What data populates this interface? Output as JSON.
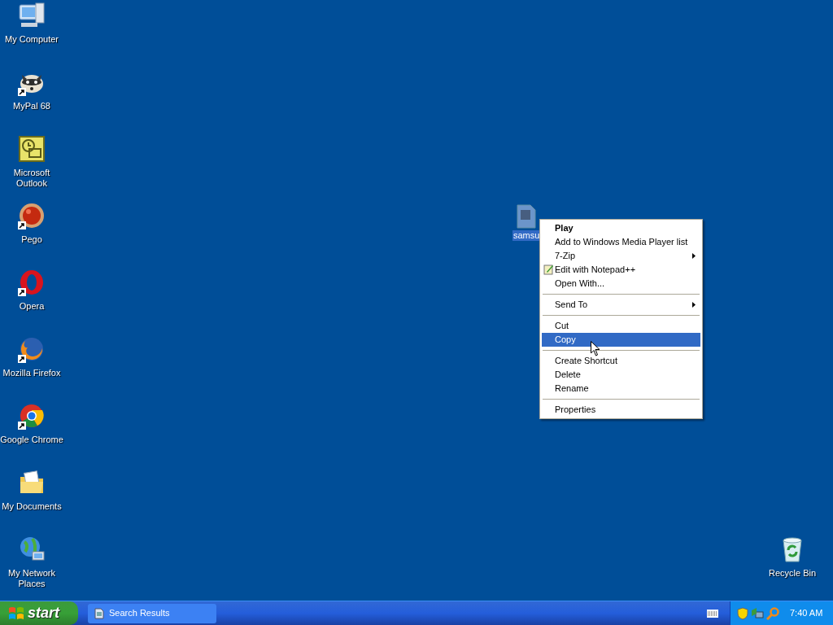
{
  "desktop_icons": [
    {
      "label": "My Computer",
      "kind": "computer",
      "shortcut": false
    },
    {
      "label": "MyPal 68",
      "kind": "raccoon",
      "shortcut": true
    },
    {
      "label": "Microsoft Outlook",
      "kind": "outlook",
      "shortcut": false
    },
    {
      "label": "Pego",
      "kind": "pego",
      "shortcut": true
    },
    {
      "label": "Opera",
      "kind": "opera",
      "shortcut": true
    },
    {
      "label": "Mozilla Firefox",
      "kind": "firefox",
      "shortcut": true
    },
    {
      "label": "Google Chrome",
      "kind": "chrome",
      "shortcut": true
    },
    {
      "label": "My Documents",
      "kind": "documents",
      "shortcut": false
    },
    {
      "label": "My Network Places",
      "kind": "network",
      "shortcut": false
    }
  ],
  "recycle_bin": {
    "label": "Recycle Bin"
  },
  "file_icon": {
    "label": "samsu",
    "selected": true
  },
  "context_menu": {
    "items": [
      {
        "kind": "item",
        "label": "Play",
        "default": true,
        "submenu": false,
        "has_icon": false,
        "selected": false
      },
      {
        "kind": "item",
        "label": "Add to Windows Media Player list",
        "default": false,
        "submenu": false,
        "has_icon": false,
        "selected": false
      },
      {
        "kind": "item",
        "label": "7-Zip",
        "default": false,
        "submenu": true,
        "has_icon": false,
        "selected": false
      },
      {
        "kind": "item",
        "label": "Edit with Notepad++",
        "default": false,
        "submenu": false,
        "has_icon": true,
        "selected": false
      },
      {
        "kind": "item",
        "label": "Open With...",
        "default": false,
        "submenu": false,
        "has_icon": false,
        "selected": false
      },
      {
        "kind": "separator"
      },
      {
        "kind": "item",
        "label": "Send To",
        "default": false,
        "submenu": true,
        "has_icon": false,
        "selected": false
      },
      {
        "kind": "separator"
      },
      {
        "kind": "item",
        "label": "Cut",
        "default": false,
        "submenu": false,
        "has_icon": false,
        "selected": false
      },
      {
        "kind": "item",
        "label": "Copy",
        "default": false,
        "submenu": false,
        "has_icon": false,
        "selected": true
      },
      {
        "kind": "separator"
      },
      {
        "kind": "item",
        "label": "Create Shortcut",
        "default": false,
        "submenu": false,
        "has_icon": false,
        "selected": false
      },
      {
        "kind": "item",
        "label": "Delete",
        "default": false,
        "submenu": false,
        "has_icon": false,
        "selected": false
      },
      {
        "kind": "item",
        "label": "Rename",
        "default": false,
        "submenu": false,
        "has_icon": false,
        "selected": false
      },
      {
        "kind": "separator"
      },
      {
        "kind": "item",
        "label": "Properties",
        "default": false,
        "submenu": false,
        "has_icon": false,
        "selected": false
      }
    ]
  },
  "taskbar": {
    "start": "start",
    "tasks": [
      {
        "label": "Search Results",
        "selected": false
      }
    ],
    "clock": "7:40 AM"
  }
}
